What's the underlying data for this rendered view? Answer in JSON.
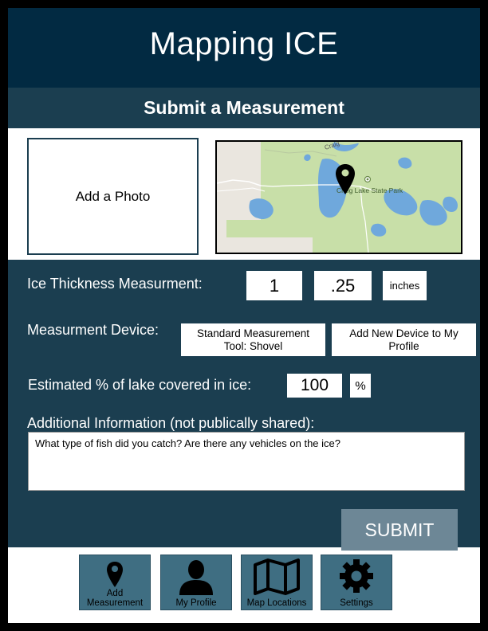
{
  "app": {
    "title": "Mapping ICE"
  },
  "form": {
    "title": "Submit a Measurement",
    "photo_label": "Add a Photo",
    "map": {
      "park_label": "Craig Lake State Park",
      "road_label": "Craig"
    },
    "thickness": {
      "label": "Ice Thickness Measurment:",
      "whole": "1",
      "fraction": ".25",
      "unit": "inches"
    },
    "device": {
      "label": "Measurment Device:",
      "current": "Standard Measurement Tool: Shovel",
      "add": "Add New Device to My Profile"
    },
    "coverage": {
      "label": "Estimated % of lake covered in ice:",
      "value": "100",
      "unit": "%"
    },
    "additional": {
      "label": "Additional Information (not publically shared):",
      "text": "What type of fish did you catch? Are there any vehicles on the ice?"
    },
    "submit_label": "SUBMIT"
  },
  "nav": {
    "items": [
      {
        "label": "Add Measurement",
        "icon": "map-pin-icon"
      },
      {
        "label": "My Profile",
        "icon": "person-icon"
      },
      {
        "label": "Map Locations",
        "icon": "map-icon"
      },
      {
        "label": "Settings",
        "icon": "gear-icon"
      }
    ]
  },
  "colors": {
    "header": "#022a42",
    "panel": "#1b3e50",
    "submit": "#6d8796",
    "nav_button": "#3f6e82",
    "water": "#6fa8dc",
    "park": "#c8dfa8"
  }
}
